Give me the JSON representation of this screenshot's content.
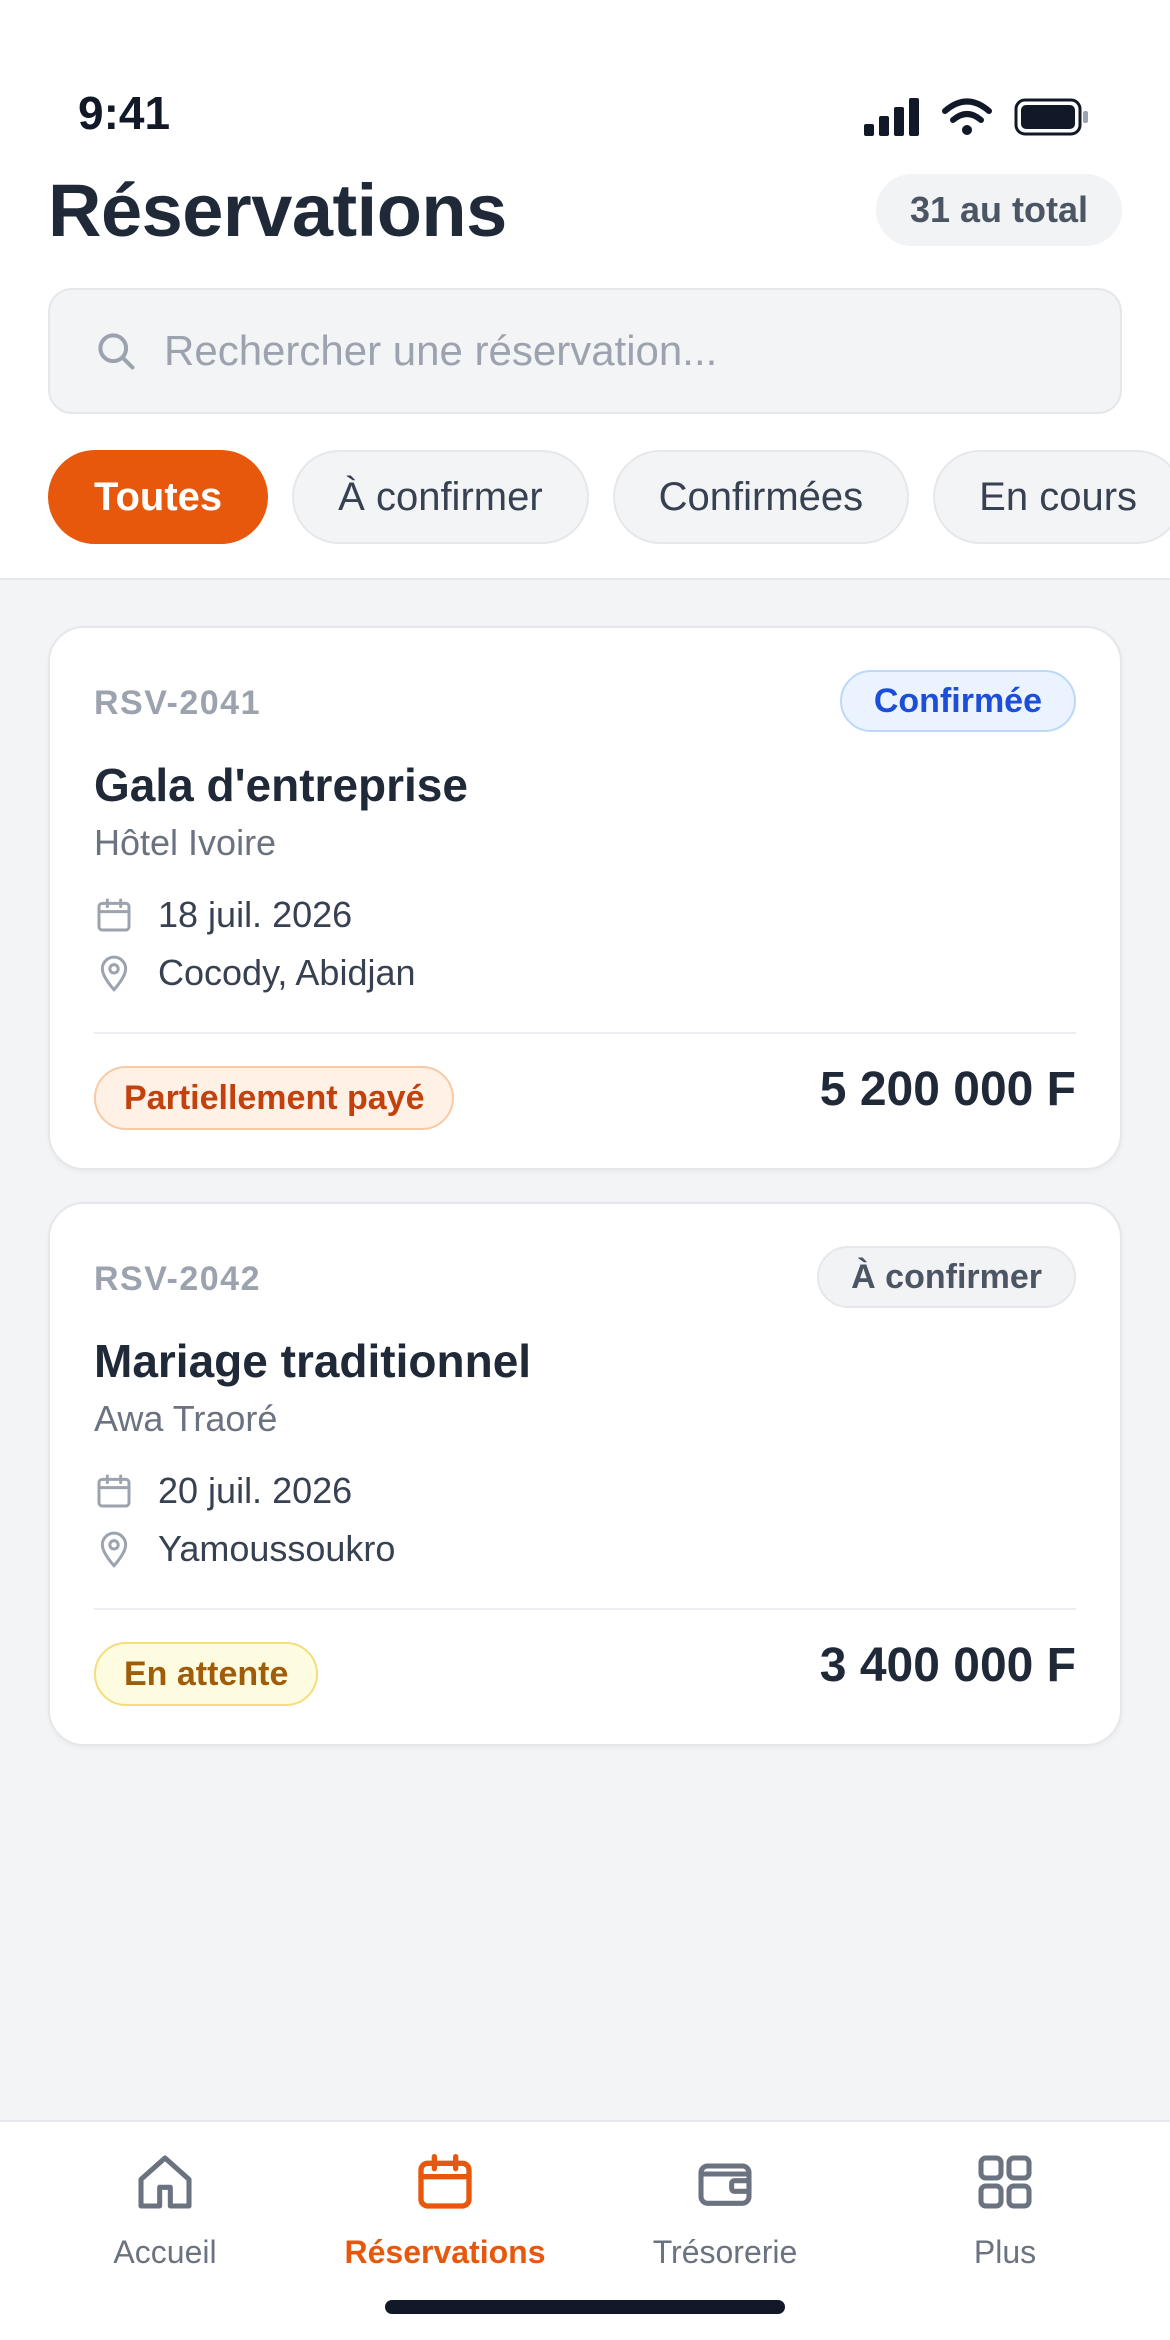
{
  "status_bar": {
    "time": "9:41"
  },
  "header": {
    "title": "Réservations",
    "total": "31 au total"
  },
  "search": {
    "placeholder": "Rechercher une réservation..."
  },
  "filters": [
    "Toutes",
    "À confirmer",
    "Confirmées",
    "En cours"
  ],
  "active_filter": "Toutes",
  "reservations": [
    {
      "ref": "RSV-2041",
      "status": "Confirmée",
      "title": "Gala d'entreprise",
      "client": "Hôtel Ivoire",
      "date": "18 juil. 2026",
      "location": "Cocody, Abidjan",
      "payment": "Partiellement payé",
      "amount": "5 200 000 F"
    },
    {
      "ref": "RSV-2042",
      "status": "À confirmer",
      "title": "Mariage traditionnel",
      "client": "Awa Traoré",
      "date": "20 juil. 2026",
      "location": "Yamoussoukro",
      "payment": "En attente",
      "amount": "3 400 000 F"
    }
  ],
  "tabbar": {
    "items": [
      {
        "label": "Accueil",
        "icon": "home-icon"
      },
      {
        "label": "Réservations",
        "icon": "calendar-icon"
      },
      {
        "label": "Trésorerie",
        "icon": "wallet-icon"
      },
      {
        "label": "Plus",
        "icon": "grid-icon"
      }
    ],
    "active": "Réservations"
  },
  "colors": {
    "accent": "#e8580c",
    "confirmed_badge": "#1d4ed8",
    "partial_badge": "#c2410c",
    "pending_badge": "#a15c07"
  }
}
